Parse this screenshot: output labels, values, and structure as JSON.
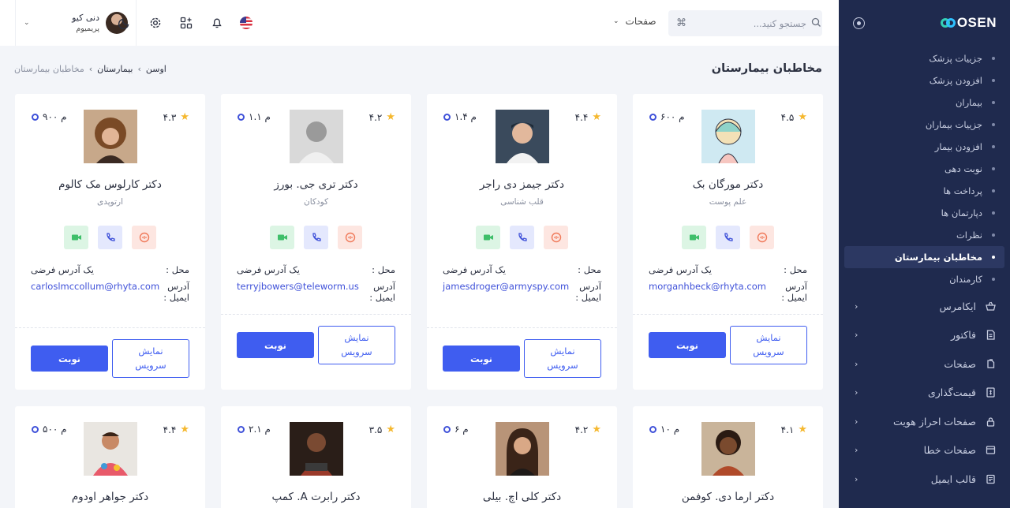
{
  "sidebar": {
    "brand": "OSEN",
    "submenu": [
      {
        "label": "جزییات پزشک"
      },
      {
        "label": "افزودن پزشک"
      },
      {
        "label": "بیماران"
      },
      {
        "label": "جزییات بیماران"
      },
      {
        "label": "افزودن بیمار"
      },
      {
        "label": "نوبت دهی"
      },
      {
        "label": "پرداخت ها"
      },
      {
        "label": "دپارتمان ها"
      },
      {
        "label": "نظرات"
      },
      {
        "label": "مخاطبان بیمارستان",
        "active": true
      },
      {
        "label": "کارمندان"
      }
    ],
    "menu": [
      {
        "label": "ایکامرس",
        "icon": "basket-icon"
      },
      {
        "label": "فاکتور",
        "icon": "invoice-icon"
      },
      {
        "label": "صفحات",
        "icon": "pages-icon"
      },
      {
        "label": "قیمت‌گذاری",
        "icon": "pricing-icon"
      },
      {
        "label": "صفحات احراز هویت",
        "icon": "lock-icon"
      },
      {
        "label": "صفحات خطا",
        "icon": "error-icon"
      },
      {
        "label": "قالب ایمیل",
        "icon": "email-template-icon"
      }
    ]
  },
  "topbar": {
    "search_placeholder": "جستجو کنید...",
    "search_shortcut": "⌘",
    "pages_label": "صفحات",
    "user_name": "دنی کیو",
    "user_role": "پریمیوم"
  },
  "page": {
    "title": "مخاطبان بیمارستان",
    "breadcrumb": [
      "اوسن",
      "بیمارستان",
      "مخاطبان بیمارستان"
    ]
  },
  "labels": {
    "location": "محل :",
    "email": "آدرس ایمیل :",
    "email_wrapped": [
      "آدرس",
      "ایمیل :"
    ],
    "address_value": "یک آدرس فرضی",
    "appointment": "نوبت",
    "show_service": "نمایش سرویس"
  },
  "doctors": [
    {
      "name": "دکتر مورگان بک",
      "specialty": "علم پوست",
      "rating": "۴.۵",
      "distance": "۶۰۰ م",
      "email": "morganhbeck@rhyta.com",
      "photo": "art"
    },
    {
      "name": "دکتر جیمز دی راجر",
      "specialty": "قلب شناسی",
      "rating": "۴.۴",
      "distance": "۱.۴ م",
      "email": "jamesdroger@armyspy.com",
      "photo": "cap"
    },
    {
      "name": "دکتر تری جی. بورز",
      "specialty": "کودکان",
      "rating": "۴.۲",
      "distance": "۱.۱ م",
      "email": "terryjbowers@teleworm.us",
      "photo": "bw"
    },
    {
      "name": "دکتر کارلوس مک کالوم",
      "specialty": "ارتوپدی",
      "rating": "۴.۳",
      "distance": "۹۰۰ م",
      "email": "carloslmccollum@rhyta.com",
      "photo": "curly"
    },
    {
      "name": "دکتر ارما دی. کوفمن",
      "rating": "۴.۱",
      "distance": "۱۰ م",
      "photo": "woman1"
    },
    {
      "name": "دکتر کلی اچ. بیلی",
      "rating": "۴.۲",
      "distance": "۶ م",
      "photo": "woman2"
    },
    {
      "name": "دکتر رابرت A. کمپ",
      "rating": "۳.۵",
      "distance": "۲.۱ م",
      "photo": "laptop"
    },
    {
      "name": "دکتر جواهر اودوم",
      "rating": "۴.۴",
      "distance": "۵۰۰ م",
      "photo": "hoodie"
    }
  ]
}
